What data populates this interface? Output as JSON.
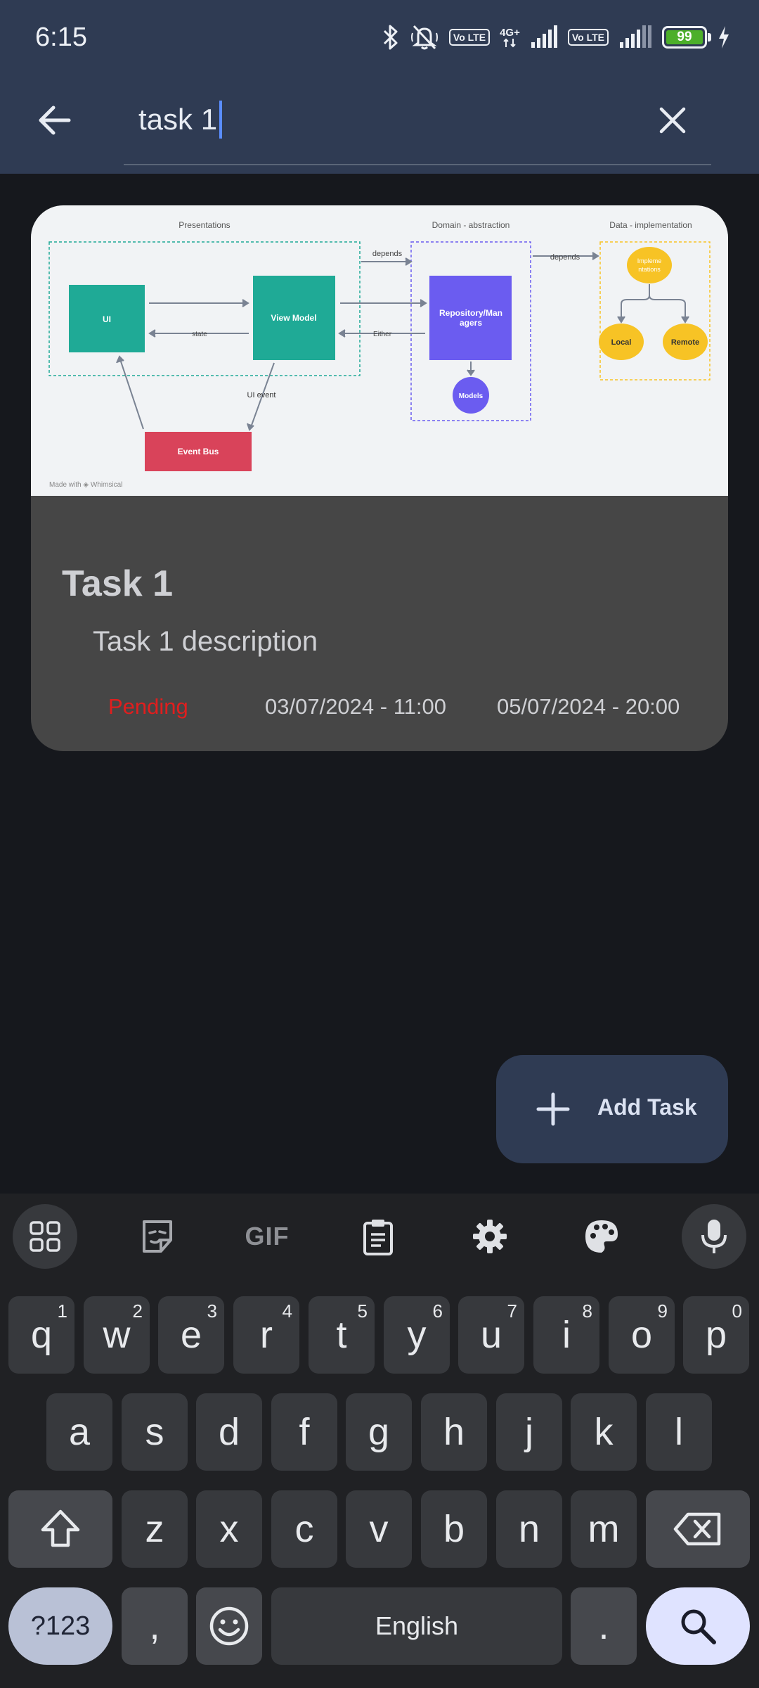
{
  "status_bar": {
    "time": "6:15",
    "volte_1": "Vo LTE",
    "network": "4G+",
    "volte_2": "Vo LTE",
    "battery": "99"
  },
  "search": {
    "value": "task 1",
    "icons": {
      "back": "arrow-left-icon",
      "clear": "close-icon"
    }
  },
  "task_card": {
    "image": {
      "section_presentations": "Presentations",
      "section_domain": "Domain - abstraction",
      "section_data": "Data - implementation",
      "box_ui": "UI",
      "box_view_model": "View Model",
      "box_repository_line1": "Repository/Man",
      "box_repository_line2": "agers",
      "box_models": "Models",
      "box_event_bus": "Event Bus",
      "box_implementations_line1": "Impleme",
      "box_implementations_line2": "ntations",
      "box_local": "Local",
      "box_remote": "Remote",
      "label_depends_1": "depends",
      "label_depends_2": "depends",
      "label_state": "state",
      "label_either": "Either",
      "label_ui_event": "UI event",
      "watermark": "Made with ◈ Whimsical"
    },
    "title": "Task 1",
    "description": "Task 1 description",
    "status": "Pending",
    "start": "03/07/2024 - 11:00",
    "end": "05/07/2024 - 20:00",
    "status_color": "#e01e1e"
  },
  "fab": {
    "label": "Add Task",
    "icon": "plus-icon"
  },
  "keyboard": {
    "toolbar": {
      "gif": "GIF"
    },
    "row1": [
      {
        "k": "q",
        "h": "1"
      },
      {
        "k": "w",
        "h": "2"
      },
      {
        "k": "e",
        "h": "3"
      },
      {
        "k": "r",
        "h": "4"
      },
      {
        "k": "t",
        "h": "5"
      },
      {
        "k": "y",
        "h": "6"
      },
      {
        "k": "u",
        "h": "7"
      },
      {
        "k": "i",
        "h": "8"
      },
      {
        "k": "o",
        "h": "9"
      },
      {
        "k": "p",
        "h": "0"
      }
    ],
    "row2": [
      "a",
      "s",
      "d",
      "f",
      "g",
      "h",
      "j",
      "k",
      "l"
    ],
    "row3": [
      "z",
      "x",
      "c",
      "v",
      "b",
      "n",
      "m"
    ],
    "symbols": "?123",
    "comma": ",",
    "space": "English",
    "period": "."
  },
  "colors": {
    "header_bg": "#2f3b53",
    "background": "#16181d",
    "card_bg": "#464646",
    "keyboard_bg": "#202124",
    "key_bg": "#37393d",
    "teal": "#1faa96",
    "purple": "#6b5cf0",
    "red": "#d9435a",
    "yellow": "#f7c325"
  }
}
